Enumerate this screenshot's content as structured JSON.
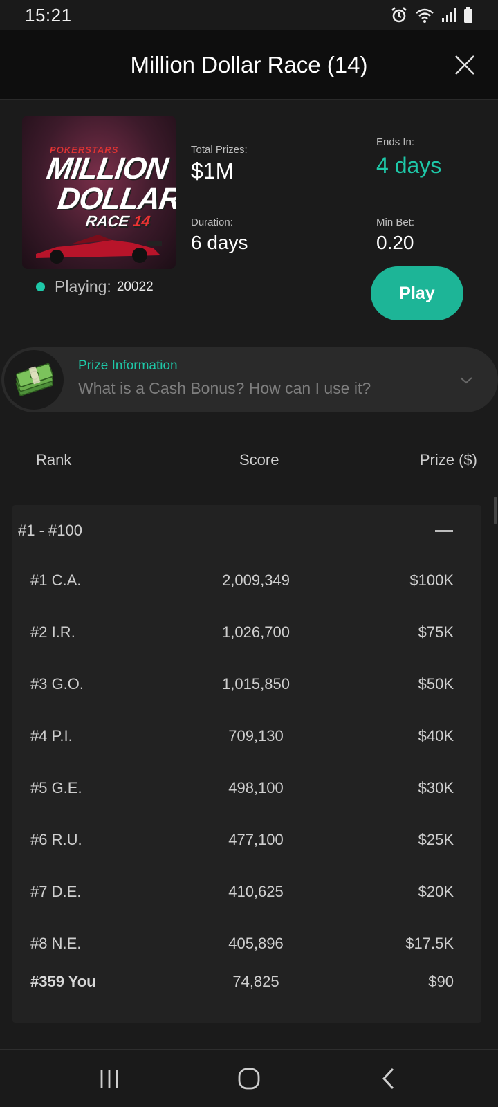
{
  "status_bar": {
    "time": "15:21"
  },
  "header": {
    "title": "Million Dollar Race (14)"
  },
  "promo": {
    "brand": "POKERSTARS",
    "line1": "MILLION",
    "line2": "DOLLAR",
    "line3": "RACE",
    "line3_num": "14"
  },
  "stats": {
    "total_prizes_label": "Total Prizes:",
    "total_prizes_value": "$1M",
    "ends_in_label": "Ends In:",
    "ends_in_value": "4 days",
    "duration_label": "Duration:",
    "duration_value": "6 days",
    "min_bet_label": "Min Bet:",
    "min_bet_value": "0.20",
    "playing_label": "Playing:",
    "playing_count": "20022"
  },
  "play_button": {
    "label": "Play"
  },
  "prize_info": {
    "title": "Prize Information",
    "subtitle": "What is a Cash Bonus? How can I use it?"
  },
  "table": {
    "headers": {
      "rank": "Rank",
      "score": "Score",
      "prize": "Prize ($)"
    },
    "group_label": "#1 - #100",
    "rows": [
      {
        "rank": "#1 C.A.",
        "score": "2,009,349",
        "prize": "$100K"
      },
      {
        "rank": "#2 I.R.",
        "score": "1,026,700",
        "prize": "$75K"
      },
      {
        "rank": "#3 G.O.",
        "score": "1,015,850",
        "prize": "$50K"
      },
      {
        "rank": "#4 P.I.",
        "score": "709,130",
        "prize": "$40K"
      },
      {
        "rank": "#5 G.E.",
        "score": "498,100",
        "prize": "$30K"
      },
      {
        "rank": "#6 R.U.",
        "score": "477,100",
        "prize": "$25K"
      },
      {
        "rank": "#7 D.E.",
        "score": "410,625",
        "prize": "$20K"
      },
      {
        "rank": "#8 N.E.",
        "score": "405,896",
        "prize": "$17.5K"
      }
    ],
    "you_row": {
      "rank": "#359 You",
      "score": "74,825",
      "prize": "$90"
    }
  },
  "colors": {
    "accent": "#1ec8a8",
    "play_button": "#1db597"
  }
}
